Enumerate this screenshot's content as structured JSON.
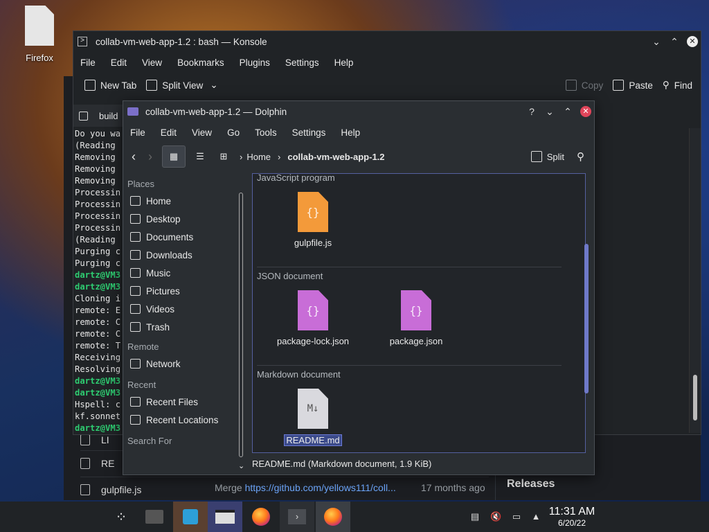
{
  "desktop": {
    "icon_label": "Firefox"
  },
  "browser_bg": {
    "rows": [
      "LI",
      "RE",
      "gulpfile.js"
    ],
    "merge_text": "Merge ",
    "merge_link": "https://github.com/yellows111/coll...",
    "ago": "17 months ago",
    "releases": "Releases"
  },
  "konsole": {
    "title": "collab-vm-web-app-1.2 : bash — Konsole",
    "menu": [
      "File",
      "Edit",
      "View",
      "Bookmarks",
      "Plugins",
      "Settings",
      "Help"
    ],
    "toolbar": {
      "new_tab": "New Tab",
      "split_view": "Split View",
      "copy": "Copy",
      "paste": "Paste",
      "find": "Find"
    },
    "tab_label": "build",
    "terminal_lines": [
      {
        "text": "Do you wa",
        "prompt": false
      },
      {
        "text": "(Reading ",
        "prompt": false
      },
      {
        "text": "Removing ",
        "prompt": false
      },
      {
        "text": "Removing ",
        "prompt": false
      },
      {
        "text": "Removing ",
        "prompt": false
      },
      {
        "text": "Processin",
        "prompt": false
      },
      {
        "text": "Processin",
        "prompt": false
      },
      {
        "text": "Processin",
        "prompt": false
      },
      {
        "text": "Processin",
        "prompt": false
      },
      {
        "text": "(Reading ",
        "prompt": false
      },
      {
        "text": "Purging c",
        "prompt": false
      },
      {
        "text": "Purging c",
        "prompt": false
      },
      {
        "text": "dartz@VM3",
        "prompt": true
      },
      {
        "text": "dartz@VM3",
        "prompt": true
      },
      {
        "text": "Cloning i",
        "prompt": false
      },
      {
        "text": "remote: E",
        "prompt": false
      },
      {
        "text": "remote: C",
        "prompt": false
      },
      {
        "text": "remote: C",
        "prompt": false
      },
      {
        "text": "remote: T",
        "prompt": false
      },
      {
        "text": "Receiving",
        "prompt": false
      },
      {
        "text": "Resolving",
        "prompt": false
      },
      {
        "text": "dartz@VM3",
        "prompt": true
      },
      {
        "text": "dartz@VM3",
        "prompt": true
      },
      {
        "text": "Hspell: c",
        "prompt": false
      },
      {
        "text": "kf.sonnet",
        "prompt": false
      },
      {
        "text": "dartz@VM3",
        "prompt": true
      }
    ]
  },
  "dolphin": {
    "title": "collab-vm-web-app-1.2 — Dolphin",
    "menu": [
      "File",
      "Edit",
      "View",
      "Go",
      "Tools",
      "Settings",
      "Help"
    ],
    "breadcrumb": {
      "home": "Home",
      "current": "collab-vm-web-app-1.2"
    },
    "split_label": "Split",
    "places": {
      "places_head": "Places",
      "places_items": [
        {
          "label": "Home",
          "icon": "home-icon"
        },
        {
          "label": "Desktop",
          "icon": "desktop-icon"
        },
        {
          "label": "Documents",
          "icon": "documents-icon"
        },
        {
          "label": "Downloads",
          "icon": "downloads-icon"
        },
        {
          "label": "Music",
          "icon": "music-icon"
        },
        {
          "label": "Pictures",
          "icon": "pictures-icon"
        },
        {
          "label": "Videos",
          "icon": "videos-icon"
        },
        {
          "label": "Trash",
          "icon": "trash-icon"
        }
      ],
      "remote_head": "Remote",
      "remote_items": [
        {
          "label": "Network",
          "icon": "network-icon"
        }
      ],
      "recent_head": "Recent",
      "recent_items": [
        {
          "label": "Recent Files",
          "icon": "recent-files-icon"
        },
        {
          "label": "Recent Locations",
          "icon": "recent-locations-icon"
        }
      ],
      "search_head": "Search For"
    },
    "groups": [
      {
        "head": "JavaScript program",
        "files": [
          "gulpfile.js"
        ]
      },
      {
        "head": "JSON document",
        "files": [
          "package-lock.json",
          "package.json"
        ]
      },
      {
        "head": "Markdown document",
        "files": [
          "README.md"
        ]
      }
    ],
    "file_colors": {
      "js": "#f39a3a",
      "json": "#c86dd7",
      "md": "#d9d9de"
    },
    "status": "README.md (Markdown document, 1.9 KiB)"
  },
  "taskbar": {
    "clock_time": "11:31 AM",
    "clock_date": "6/20/22"
  }
}
